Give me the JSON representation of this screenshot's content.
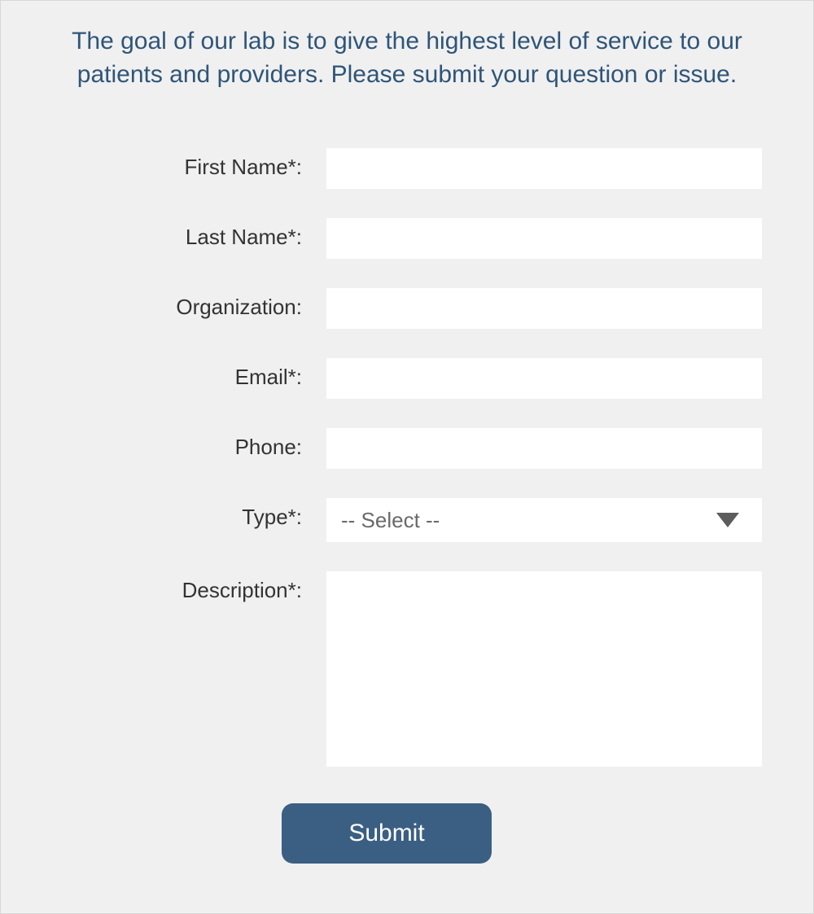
{
  "intro_text": "The goal of our lab is to give the highest level of service to our patients and providers. Please submit your question or issue.",
  "form": {
    "first_name": {
      "label": "First Name*:",
      "value": ""
    },
    "last_name": {
      "label": "Last Name*:",
      "value": ""
    },
    "organization": {
      "label": "Organization:",
      "value": ""
    },
    "email": {
      "label": "Email*:",
      "value": ""
    },
    "phone": {
      "label": "Phone:",
      "value": ""
    },
    "type": {
      "label": "Type*:",
      "selected": "-- Select --"
    },
    "description": {
      "label": "Description*:",
      "value": ""
    },
    "submit_label": "Submit"
  }
}
